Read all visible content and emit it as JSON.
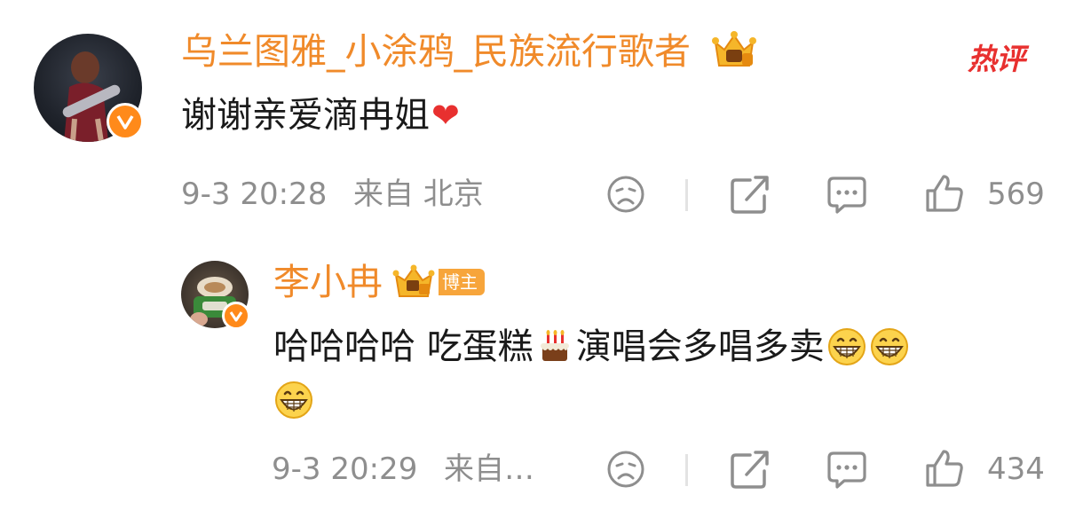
{
  "comment": {
    "username": "乌兰图雅_小涂鸦_民族流行歌者",
    "hot_label": "热评",
    "text": "谢谢亲爱滴冉姐",
    "emoji_heart": "❤",
    "time": "9-3 20:28",
    "location": "来自 北京",
    "like_count": "569",
    "reply": {
      "username": "李小冉",
      "host_badge": "博主",
      "text_part1": "哈哈哈哈 吃蛋糕",
      "text_part2": "演唱会多唱多卖",
      "time": "9-3 20:29",
      "location": "来自…",
      "like_count": "434"
    }
  },
  "colors": {
    "username": "#f08a2a",
    "hot": "#e8302f",
    "verified_badge": "#ff8a1a",
    "meta": "#8e8e8e"
  },
  "icons": [
    "verified-icon",
    "crown-badge-icon",
    "dislike-face-icon",
    "share-icon",
    "comment-icon",
    "like-icon",
    "cake-emoji-icon",
    "grin-emoji-icon",
    "heart-emoji-icon"
  ]
}
